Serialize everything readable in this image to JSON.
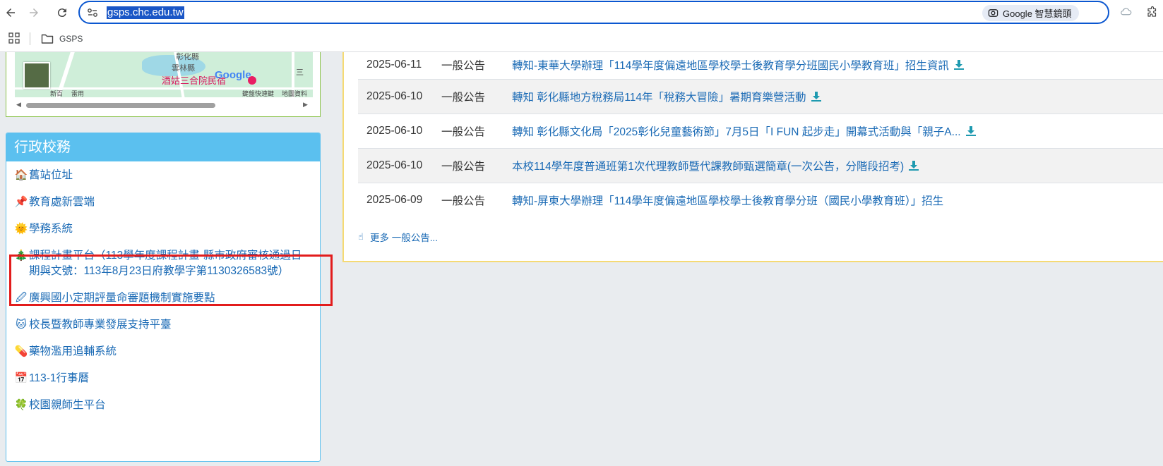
{
  "browser": {
    "url": "gsps.chc.edu.tw",
    "lens_label": "Google 智慧鏡頭",
    "bookmark_folder": "GSPS"
  },
  "map": {
    "labels": {
      "top_road": "彰化縣",
      "county": "雲林縣",
      "right_char": "三"
    },
    "poi": "酒姑三合院民宿",
    "logo": "Google",
    "footer": {
      "left": "鍵盤快速鍵",
      "right": "地圖資料",
      "bottom_left_a": "新百",
      "bottom_left_b": "雷用"
    }
  },
  "admin": {
    "title": "行政校務",
    "items": [
      {
        "emoji": "🏠",
        "label": "舊站位址"
      },
      {
        "emoji": "📌",
        "label": "教育處新雲端"
      },
      {
        "emoji": "🌞",
        "label": "學務系統"
      },
      {
        "emoji": "🎄",
        "label": "課程計畫平台（113學年度課程計畫-縣市政府審核通過日期與文號：113年8月23日府教學字第1130326583號）"
      },
      {
        "emoji": "🖉",
        "label": "廣興國小定期評量命審題機制實施要點"
      },
      {
        "emoji": "🐱",
        "label": "校長暨教師專業發展支持平臺"
      },
      {
        "emoji": "💊",
        "label": "藥物濫用追輔系統"
      },
      {
        "emoji": "📅",
        "label": "113-1行事曆"
      },
      {
        "emoji": "🍀",
        "label": "校園親師生平台"
      }
    ]
  },
  "announcements": {
    "rows": [
      {
        "date": "2025-06-11",
        "category": "一般公告",
        "title": "轉知-東華大學辦理「114學年度偏遠地區學校學士後教育學分班國民小學教育班」招生資訊",
        "download": true
      },
      {
        "date": "2025-06-10",
        "category": "一般公告",
        "title": "轉知 彰化縣地方稅務局114年「稅務大冒險」暑期育樂營活動",
        "download": true
      },
      {
        "date": "2025-06-10",
        "category": "一般公告",
        "title": "轉知 彰化縣文化局「2025彰化兒童藝術節」7月5日「I FUN 起步走」開幕式活動與「親子A...",
        "download": true
      },
      {
        "date": "2025-06-10",
        "category": "一般公告",
        "title": "本校114學年度普通班第1次代理教師暨代課教師甄選簡章(一次公告，分階段招考)",
        "download": true
      },
      {
        "date": "2025-06-09",
        "category": "一般公告",
        "title": "轉知-屏東大學辦理「114學年度偏遠地區學校學士後教育學分班（國民小學教育班）」招生",
        "download": false
      }
    ],
    "more_label": "更多 一般公告..."
  },
  "colors": {
    "admin_header": "#5bc0ef",
    "link": "#1a6ab5",
    "highlight": "#e21c1c",
    "panel_border_yellow": "#f5da74",
    "download_icon": "#1e9ab0"
  }
}
